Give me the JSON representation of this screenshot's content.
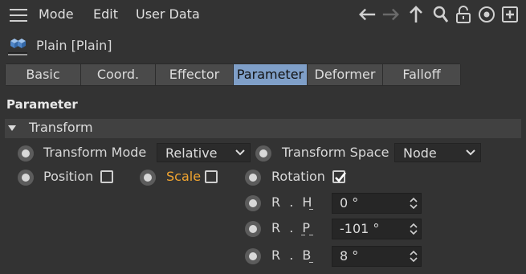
{
  "menubar": {
    "items": [
      "Mode",
      "Edit",
      "User Data"
    ]
  },
  "object": {
    "title": "Plain [Plain]"
  },
  "tabs": [
    {
      "label": "Basic",
      "active": false
    },
    {
      "label": "Coord.",
      "active": false
    },
    {
      "label": "Effector",
      "active": false
    },
    {
      "label": "Parameter",
      "active": true
    },
    {
      "label": "Deformer",
      "active": false
    },
    {
      "label": "Falloff",
      "active": false
    }
  ],
  "section": {
    "heading": "Parameter",
    "group": "Transform"
  },
  "fields": {
    "transform_mode_label": "Transform Mode",
    "transform_mode_value": "Relative",
    "transform_space_label": "Transform Space",
    "transform_space_value": "Node",
    "position_label": "Position",
    "position_checked": false,
    "scale_label": "Scale",
    "scale_checked": false,
    "rotation_label": "Rotation",
    "rotation_checked": true,
    "rh_label": "R . H",
    "rh_value": "0 °",
    "rp_label": "R . P",
    "rp_value": "-101 °",
    "rb_label": "R . B",
    "rb_value": "8 °"
  },
  "colors": {
    "background": "#333333",
    "active_tab": "#7f9fc8",
    "scale_label": "#f0a430"
  }
}
